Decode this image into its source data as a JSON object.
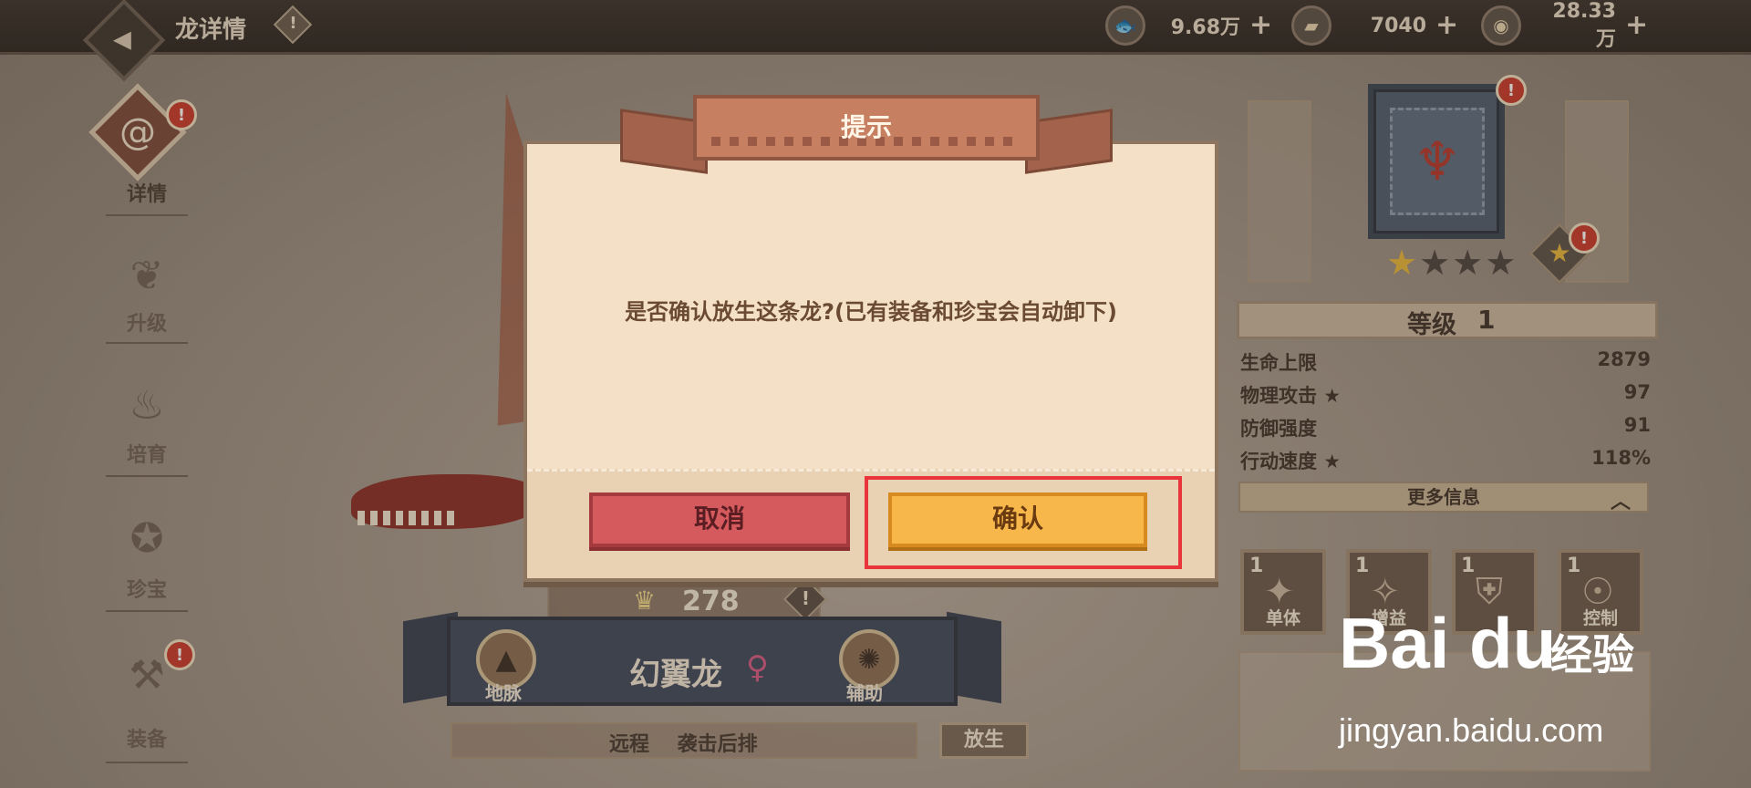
{
  "header": {
    "title": "龙详情",
    "info_icon": "!",
    "currencies": [
      {
        "icon": "fish-icon",
        "value": "9.68万",
        "plus": "+"
      },
      {
        "icon": "iron-icon",
        "value": "7040",
        "plus": "+"
      },
      {
        "icon": "coin-icon",
        "value": "28.33万",
        "plus": "+"
      }
    ]
  },
  "sidebar": {
    "items": [
      {
        "label": "详情",
        "active": true,
        "badge": "!"
      },
      {
        "label": "升级",
        "active": false
      },
      {
        "label": "培育",
        "active": false
      },
      {
        "label": "珍宝",
        "active": false
      },
      {
        "label": "装备",
        "active": false,
        "badge": "!"
      }
    ]
  },
  "dragon": {
    "power": "278",
    "name": "幻翼龙",
    "gender": "♀",
    "traits": [
      {
        "label": "地脉"
      },
      {
        "label": "辅助"
      }
    ],
    "tags": "远程    袭击后排",
    "release_label": "放生"
  },
  "right_panel": {
    "level_label": "等级",
    "level_value": "1",
    "stars_filled": 1,
    "stars_total": 4,
    "stats": [
      {
        "name": "生命上限",
        "value": "2879"
      },
      {
        "name": "物理攻击 ★",
        "value": "97"
      },
      {
        "name": "防御强度",
        "value": "91"
      },
      {
        "name": "行动速度 ★",
        "value": "118%"
      }
    ],
    "more_info": "更多信息",
    "skills": [
      {
        "level": "1",
        "label": "单体"
      },
      {
        "level": "1",
        "label": "增益"
      },
      {
        "level": "1",
        "label": ""
      },
      {
        "level": "1",
        "label": "控制"
      }
    ]
  },
  "dialog": {
    "title": "提示",
    "message": "是否确认放生这条龙?(已有装备和珍宝会自动卸下)",
    "cancel_label": "取消",
    "confirm_label": "确认"
  },
  "watermark": {
    "logo": "Bai du",
    "brand": "经验",
    "url": "jingyan.baidu.com"
  },
  "colors": {
    "confirm": "#f7b74a",
    "cancel": "#d45a5e",
    "highlight": "#e8343a"
  }
}
